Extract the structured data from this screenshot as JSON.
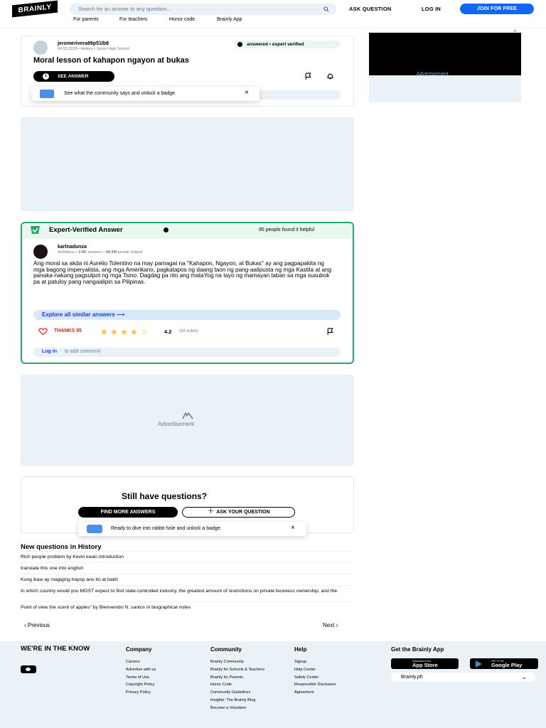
{
  "header": {
    "logo": "BRAINLY",
    "search_placeholder": "Search for an answer to any question...",
    "ask_question": "ASK QUESTION",
    "log_in": "LOG IN",
    "join": "JOIN FOR FREE",
    "sub_links": [
      "For parents",
      "For teachers",
      "Honor code",
      "Brainly App"
    ]
  },
  "question": {
    "user": "jeromerivera89p51lb8",
    "date": "04.03.2018",
    "subject": "History",
    "level": "Junior High School",
    "badge": "answered • expert verified",
    "title": "Moral lesson of kahapon ngayon at bukas",
    "see_answer": "SEE ANSWER",
    "answer_count": "1",
    "toast": "See what the community says and unlock a badge."
  },
  "expert": {
    "title": "Expert-Verified Answer",
    "helpful": "95 people found it helpful",
    "user": "karlnadunza",
    "rank": "Ambitious",
    "answers": "2.8K",
    "answers_label": "answers",
    "helped": "48.3M",
    "helped_label": "people helped",
    "text": "Ang moral sa akda ni Aurelio Tolentino na may pamagat na \"Kahapon, Ngayon, at Bukas\" ay ang pagpapakita ng mga bagong imperyalista, ang mga Amerikano, pagkatapos ng daang taon ng pang-aalipusta ng mga Kastila at ang panaka-nakang pagsulpot ng mga Tsino. Dagdag pa rito ang mataYog na tayo ng mamayan laban sa mga susubok pa at patuloy pang nangaalipin sa Pilipinas.",
    "explore": "Explore all similar answers",
    "thanks": "THANKS 95",
    "rating": "4.2",
    "votes": "(42 votes)",
    "rating_fraction": 0.84,
    "login": "Log in",
    "add_comment": "to add comment"
  },
  "ads": {
    "label": "Advertisement"
  },
  "still": {
    "title": "Still have questions?",
    "find_more": "FIND MORE ANSWERS",
    "ask_yours": "ASK YOUR QUESTION",
    "toast": "Ready to dive into rabbit hole and unlock a badge."
  },
  "new_questions": {
    "title": "New questions in History",
    "items": [
      "Rich people problem by Kevin kwan introduction",
      "translate this one into english",
      "Kung ikaw ay magiging hayop ano ito at bakit",
      "In which country would you MOST expect to find state-controlled industry, the greatest amount of restrictions on private business ownership, and the",
      "Point of view the scent of apples\" by Bienvenido N. santos in biographical notes"
    ],
    "previous": "Previous",
    "next": "Next"
  },
  "footer": {
    "tagline": "WE'RE IN THE KNOW",
    "company": {
      "title": "Company",
      "links": [
        "Careers",
        "Advertise with us",
        "Terms of Use",
        "Copyright Policy",
        "Privacy Policy"
      ]
    },
    "community": {
      "title": "Community",
      "links": [
        "Brainly Community",
        "Brainly for Schools & Teachers",
        "Brainly for Parents",
        "Honor Code",
        "Community Guidelines",
        "Insights: The Brainly Blog",
        "Become a Volunteer"
      ]
    },
    "help": {
      "title": "Help",
      "links": [
        "Signup",
        "Help Center",
        "Safety Center",
        "Responsible Disclosure",
        "Agreement"
      ]
    },
    "app": {
      "title": "Get the Brainly App",
      "app_store_small": "Download on the",
      "app_store": "App Store",
      "google_small": "GET IT ON",
      "google": "Google Play"
    },
    "region": "Brainly.ph"
  },
  "colors": {
    "brand_blue": "#0f67f4",
    "expert_green": "#24a865",
    "light_bg": "#ebf2f7",
    "star": "#fbbe2e",
    "thanks_red": "#e8211c"
  }
}
